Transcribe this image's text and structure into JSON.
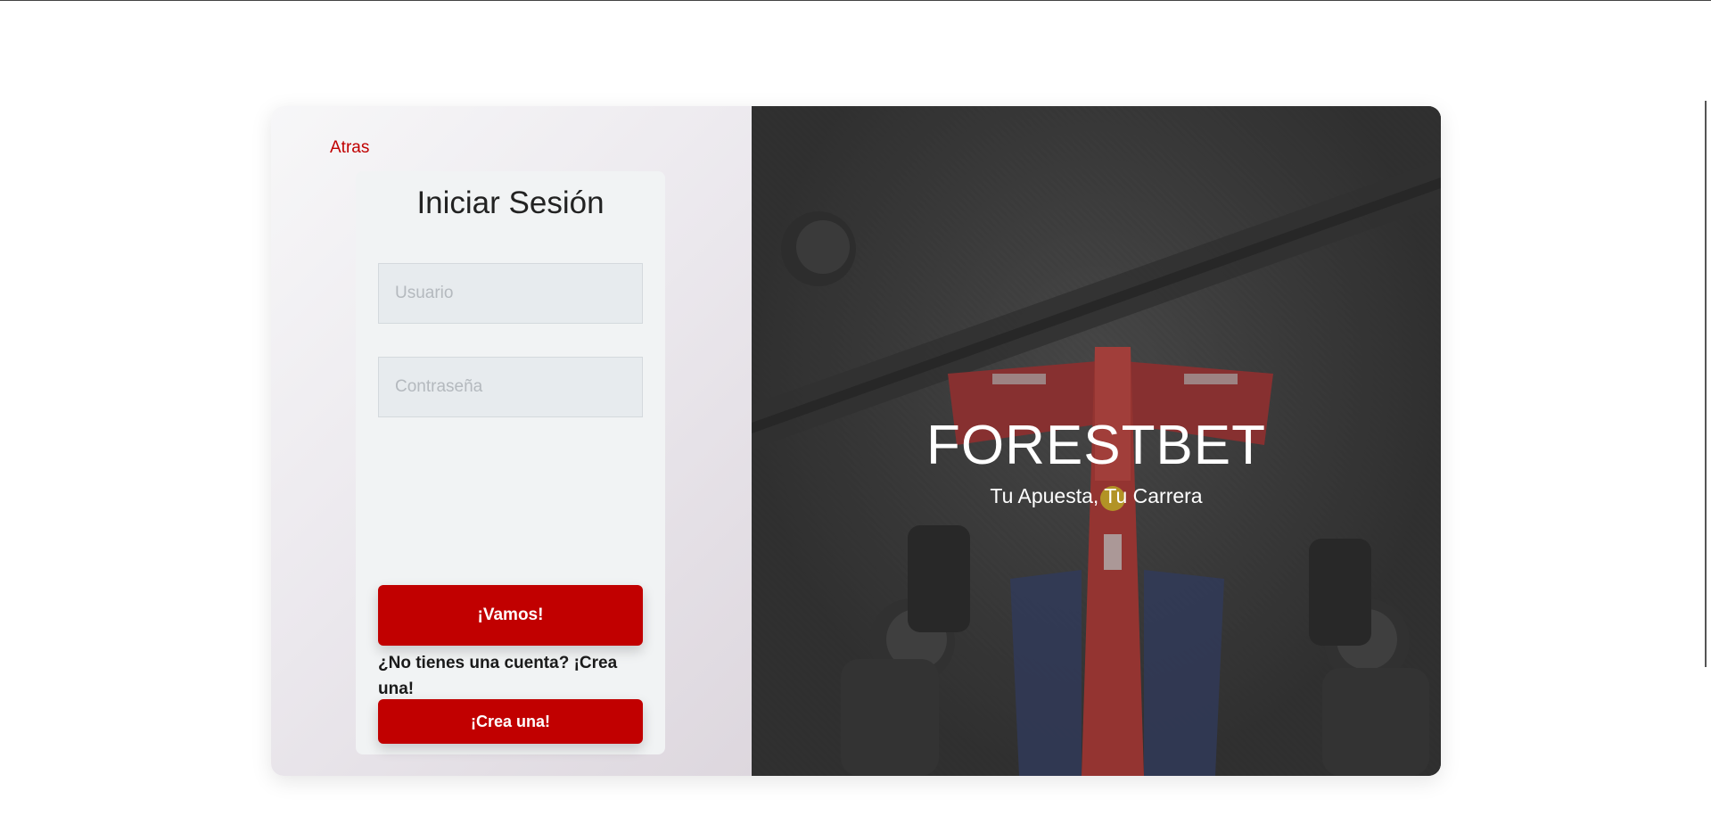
{
  "login": {
    "back_label": "Atras",
    "title": "Iniciar Sesión",
    "username_placeholder": "Usuario",
    "password_placeholder": "Contraseña",
    "submit_label": "¡Vamos!",
    "no_account_text": "¿No tienes una cuenta? ¡Crea una!",
    "create_label": "¡Crea una!"
  },
  "hero": {
    "brand": "FORESTBET",
    "tagline": "Tu Apuesta, Tu Carrera",
    "image_subject": "pit-stop-f1-car-photo"
  },
  "colors": {
    "accent": "#c10000",
    "link": "#c00000",
    "form_bg": "#f1f3f4",
    "field_bg": "#e7ebee"
  }
}
